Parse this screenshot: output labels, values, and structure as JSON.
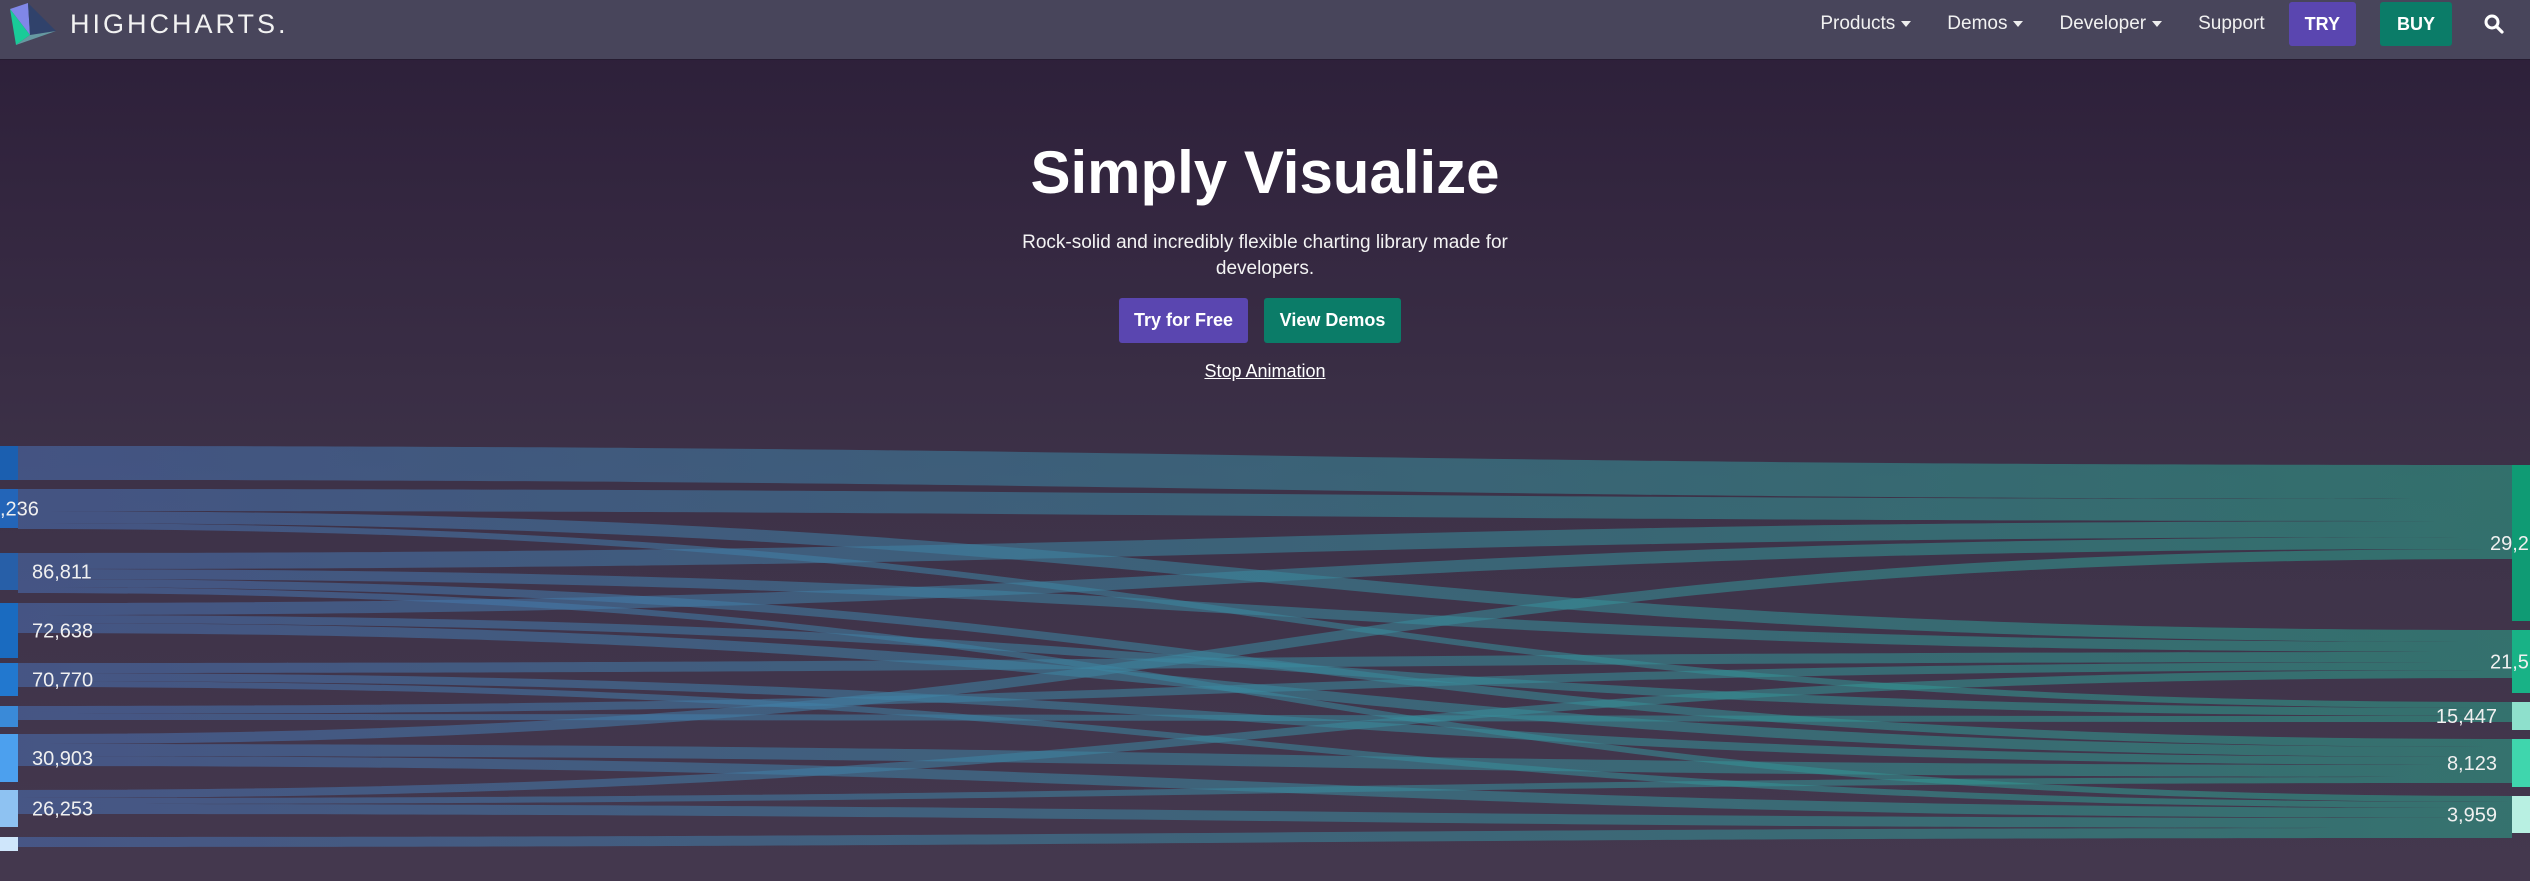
{
  "header": {
    "logo_text": "HIGHCHARTS.",
    "nav": [
      {
        "label": "Products",
        "dropdown": true
      },
      {
        "label": "Demos",
        "dropdown": true
      },
      {
        "label": "Developer",
        "dropdown": true
      },
      {
        "label": "Support",
        "dropdown": false
      }
    ],
    "try_label": "TRY",
    "buy_label": "BUY",
    "search_icon": "search-icon"
  },
  "hero": {
    "title": "Simply Visualize",
    "subtitle": "Rock-solid and incredibly flexible charting library made for developers.",
    "try_button": "Try for Free",
    "demos_button": "View Demos",
    "stop_animation": "Stop Animation"
  },
  "colors": {
    "header_bg": "#48455b",
    "try_purple": "#5a46b0",
    "buy_green": "#0b7c68",
    "flow_start": "#4a6fb3",
    "flow_end": "#2aa38a"
  },
  "chart_data": {
    "type": "sankey",
    "left_nodes": [
      {
        "label": "",
        "value": null,
        "color": "#1b5fb0"
      },
      {
        "label": ",236",
        "value": null,
        "color": "#2365b8"
      },
      {
        "label": "86,811",
        "value": 86811,
        "color": "#275fa8"
      },
      {
        "label": "72,638",
        "value": 72638,
        "color": "#1a6bc0"
      },
      {
        "label": "70,770",
        "value": 70770,
        "color": "#2278cf"
      },
      {
        "label": "",
        "value": null,
        "color": "#3a8ad8"
      },
      {
        "label": "30,903",
        "value": 30903,
        "color": "#4ca0ee"
      },
      {
        "label": "26,253",
        "value": 26253,
        "color": "#8ec2f2"
      },
      {
        "label": "",
        "value": null,
        "color": "#cfe6fb"
      }
    ],
    "right_nodes": [
      {
        "label": "29,2",
        "value": null,
        "color": "#0f9b74"
      },
      {
        "label": "21,5",
        "value": null,
        "color": "#18b286"
      },
      {
        "label": "15,447",
        "value": 15447,
        "color": "#8ee0cc"
      },
      {
        "label": "8,123",
        "value": 8123,
        "color": "#3fd6ad"
      },
      {
        "label": "3,959",
        "value": 3959,
        "color": "#b8f0e2"
      }
    ]
  }
}
